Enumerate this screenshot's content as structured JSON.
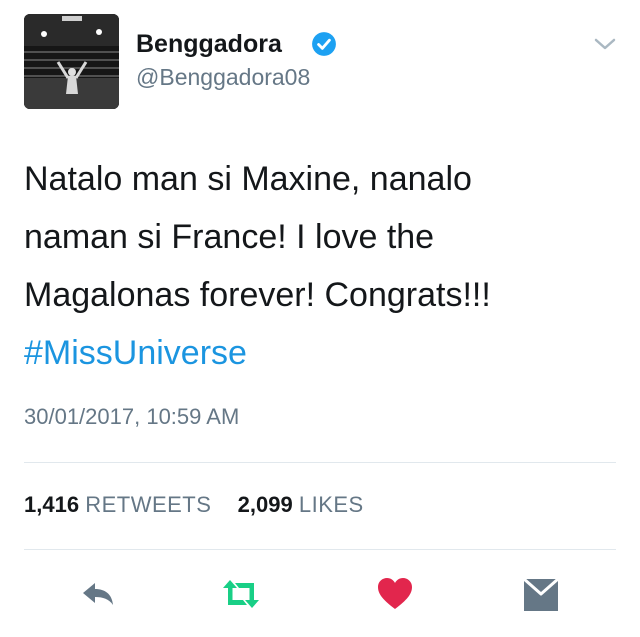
{
  "user": {
    "display_name": "Benggadora",
    "handle": "@Benggadora08",
    "verified": true,
    "verified_icon": "verified-badge-icon",
    "verified_color": "#1da1f2"
  },
  "tweet": {
    "lines": [
      "Natalo man si Maxine, nanalo",
      "naman si France! I love the",
      "Magalonas forever! Congrats!!!"
    ],
    "hashtag": "#MissUniverse",
    "hashtag_color": "#1b95e0",
    "timestamp": "30/01/2017, 10:59 AM"
  },
  "stats": {
    "retweets_count": "1,416",
    "retweets_label": "RETWEETS",
    "likes_count": "2,099",
    "likes_label": "LIKES"
  },
  "actions": [
    {
      "name": "reply",
      "icon": "reply-icon",
      "color": "#657786"
    },
    {
      "name": "retweet",
      "icon": "retweet-icon",
      "color": "#19cf86"
    },
    {
      "name": "like",
      "icon": "heart-icon",
      "color": "#e2264d"
    },
    {
      "name": "direct-message",
      "icon": "envelope-icon",
      "color": "#657786"
    }
  ],
  "header_menu_icon": "chevron-down-icon"
}
